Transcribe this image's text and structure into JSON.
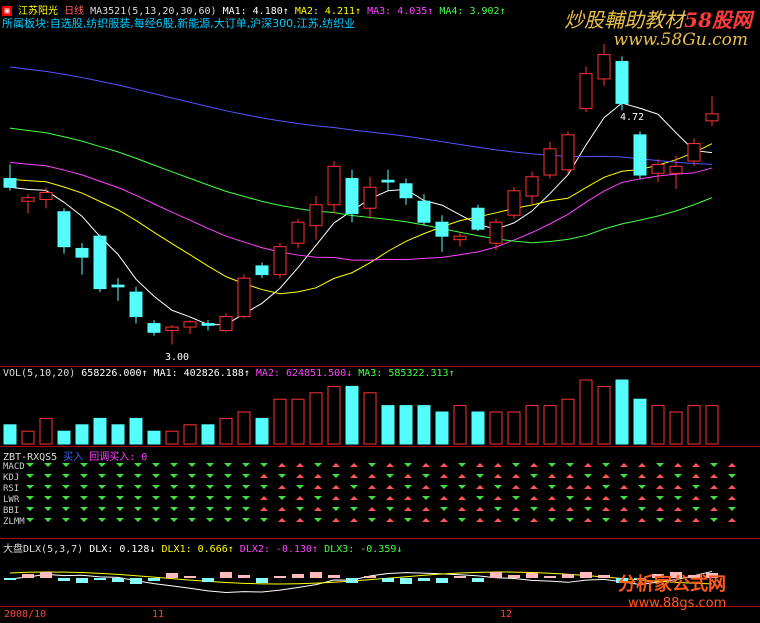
{
  "header": {
    "stock_name": "江苏阳光",
    "period": "日线",
    "ma_title": "MA3521(5,13,20,30,60)",
    "ma1": "MA1: 4.180↑",
    "ma2": "MA2: 4.211↑",
    "ma3": "MA3: 4.035↑",
    "ma4": "MA4: 3.902↑",
    "sectors": "所属板块:自选股,纺织服装,每经6股,新能源,大订单,沪深300,江苏,纺织业"
  },
  "watermarks": {
    "top_brand": "炒股輔助教材",
    "top_brand_red": "58股网",
    "top_url": "www.58Gu.com",
    "bottom_brand": "分析家公式网",
    "bottom_url": "www.88gs.com"
  },
  "price_panel": {
    "high_label": "4.72",
    "low_label": "3.00"
  },
  "volume_panel": {
    "title": "VOL(5,10,20)",
    "vol": "658226.000↑",
    "ma1": "MA1: 402826.188↑",
    "ma2": "MA2: 624851.500↓",
    "ma3": "MA3: 585322.313↑"
  },
  "zbt_panel": {
    "title": "ZBT-RXQS5",
    "status1": "买入",
    "status2": "回调买入: 0",
    "indicators": [
      "MACD",
      "KDJ",
      "RSI",
      "LWR",
      "BBI",
      "ZLMM"
    ]
  },
  "dlx_panel": {
    "title": "大盘DLX(5,3,7)",
    "dlx": "DLX: 0.128↓",
    "dlx1": "DLX1: 0.666↑",
    "dlx2": "DLX2: -0.130↑",
    "dlx3": "DLX3: -0.359↓"
  },
  "time_axis": [
    "2008/10",
    "11",
    "12"
  ],
  "chart_data": {
    "type": "candlestick",
    "candles": [
      {
        "o": 3.95,
        "h": 4.03,
        "l": 3.88,
        "c": 3.9
      },
      {
        "o": 3.82,
        "h": 3.86,
        "l": 3.75,
        "c": 3.84
      },
      {
        "o": 3.83,
        "h": 3.9,
        "l": 3.78,
        "c": 3.87
      },
      {
        "o": 3.76,
        "h": 3.78,
        "l": 3.52,
        "c": 3.56
      },
      {
        "o": 3.55,
        "h": 3.58,
        "l": 3.4,
        "c": 3.5
      },
      {
        "o": 3.62,
        "h": 3.63,
        "l": 3.3,
        "c": 3.32
      },
      {
        "o": 3.34,
        "h": 3.38,
        "l": 3.25,
        "c": 3.33
      },
      {
        "o": 3.3,
        "h": 3.33,
        "l": 3.12,
        "c": 3.16
      },
      {
        "o": 3.12,
        "h": 3.14,
        "l": 3.05,
        "c": 3.07
      },
      {
        "o": 3.08,
        "h": 3.11,
        "l": 3.0,
        "c": 3.1
      },
      {
        "o": 3.1,
        "h": 3.14,
        "l": 3.06,
        "c": 3.13
      },
      {
        "o": 3.12,
        "h": 3.14,
        "l": 3.08,
        "c": 3.11
      },
      {
        "o": 3.08,
        "h": 3.18,
        "l": 3.07,
        "c": 3.16
      },
      {
        "o": 3.16,
        "h": 3.4,
        "l": 3.15,
        "c": 3.38
      },
      {
        "o": 3.45,
        "h": 3.47,
        "l": 3.38,
        "c": 3.4
      },
      {
        "o": 3.4,
        "h": 3.58,
        "l": 3.38,
        "c": 3.56
      },
      {
        "o": 3.58,
        "h": 3.72,
        "l": 3.55,
        "c": 3.7
      },
      {
        "o": 3.68,
        "h": 3.85,
        "l": 3.6,
        "c": 3.8
      },
      {
        "o": 3.8,
        "h": 4.05,
        "l": 3.75,
        "c": 4.02
      },
      {
        "o": 3.95,
        "h": 4.0,
        "l": 3.7,
        "c": 3.75
      },
      {
        "o": 3.78,
        "h": 3.96,
        "l": 3.72,
        "c": 3.9
      },
      {
        "o": 3.94,
        "h": 4.0,
        "l": 3.88,
        "c": 3.93
      },
      {
        "o": 3.92,
        "h": 3.95,
        "l": 3.8,
        "c": 3.84
      },
      {
        "o": 3.82,
        "h": 3.86,
        "l": 3.68,
        "c": 3.7
      },
      {
        "o": 3.7,
        "h": 3.74,
        "l": 3.53,
        "c": 3.62
      },
      {
        "o": 3.6,
        "h": 3.64,
        "l": 3.56,
        "c": 3.62
      },
      {
        "o": 3.78,
        "h": 3.8,
        "l": 3.65,
        "c": 3.66
      },
      {
        "o": 3.58,
        "h": 3.72,
        "l": 3.54,
        "c": 3.7
      },
      {
        "o": 3.74,
        "h": 3.9,
        "l": 3.72,
        "c": 3.88
      },
      {
        "o": 3.85,
        "h": 3.99,
        "l": 3.8,
        "c": 3.96
      },
      {
        "o": 3.97,
        "h": 4.16,
        "l": 3.95,
        "c": 4.12
      },
      {
        "o": 4.0,
        "h": 4.22,
        "l": 3.98,
        "c": 4.2
      },
      {
        "o": 4.35,
        "h": 4.59,
        "l": 4.33,
        "c": 4.55
      },
      {
        "o": 4.52,
        "h": 4.72,
        "l": 4.48,
        "c": 4.66
      },
      {
        "o": 4.62,
        "h": 4.65,
        "l": 4.34,
        "c": 4.38
      },
      {
        "o": 4.2,
        "h": 4.22,
        "l": 3.95,
        "c": 3.97
      },
      {
        "o": 3.98,
        "h": 4.06,
        "l": 3.93,
        "c": 4.03
      },
      {
        "o": 3.98,
        "h": 4.08,
        "l": 3.89,
        "c": 4.02
      },
      {
        "o": 4.05,
        "h": 4.18,
        "l": 4.02,
        "c": 4.15
      },
      {
        "o": 4.28,
        "h": 4.42,
        "l": 4.25,
        "c": 4.32
      }
    ],
    "volume": [
      3,
      2,
      4,
      2,
      3,
      4,
      3,
      4,
      2,
      2,
      3,
      3,
      4,
      5,
      4,
      7,
      7,
      8,
      9,
      9,
      8,
      6,
      6,
      6,
      5,
      6,
      5,
      5,
      5,
      6,
      6,
      7,
      10,
      9,
      10,
      7,
      6,
      5,
      6,
      6
    ],
    "ylim": [
      2.9,
      4.8
    ]
  }
}
